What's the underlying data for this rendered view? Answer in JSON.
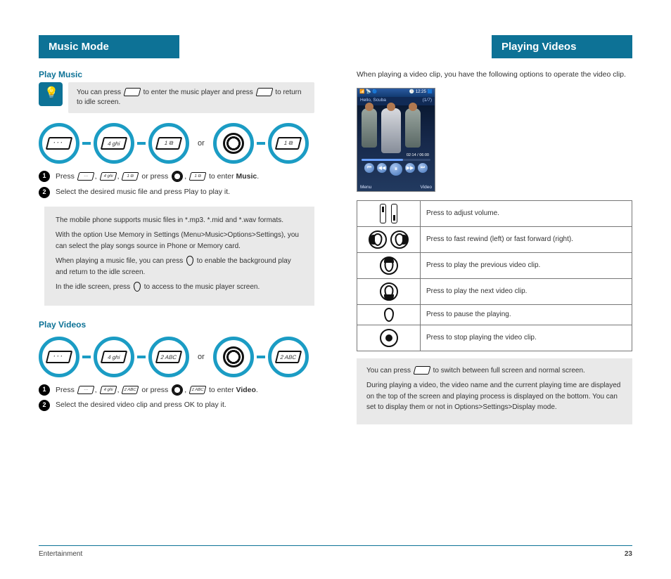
{
  "left": {
    "section_title": "Music Mode",
    "sub1": "Play Music",
    "tip": "You can press  to enter the music player and press  to return to idle screen.",
    "chain1_or": "or",
    "step1": "Press 4, 1 or press , 1 to enter Music.",
    "step2": "Select the desired music file and press Play to play it.",
    "box": {
      "l1": "The mobile phone supports music files in *.mp3. *.mid and *.wav formats.",
      "l2": "With the option Use Memory in Settings (Menu>Music>Options>Settings), you can select the play songs source in Phone or Memory card.",
      "l3": "When playing a music file, you can press  to enable the background play and return to the idle screen.",
      "l4": "In the idle screen, press  to access to the music player screen."
    },
    "sub2": "Play Videos",
    "chain2_or": "or",
    "step3": "Press 4, 2 or press , 2 to enter Video.",
    "step4": "Select the desired video clip and press OK to play it."
  },
  "right": {
    "section_title": "Playing Videos",
    "intro": "When playing a video clip, you have the following options to operate the video clip.",
    "phone": {
      "status_left": "📶 📡 🔵",
      "status_right": "🕒 12:25 🟦",
      "title_left": "Hello, Scuba",
      "title_right": "(1/7)",
      "time": "02:14 / 06:00",
      "sk_left": "Menu",
      "sk_right": "Video"
    },
    "table": {
      "r1": "Press to adjust volume.",
      "r2": "Press to fast rewind (left) or fast forward (right).",
      "r3": "Press to play the previous video clip.",
      "r4": "Press to play the next video clip.",
      "r5": "Press to pause the playing.",
      "r6": "Press to stop playing the video clip."
    },
    "tip": {
      "l1": "You can press  to switch between full screen and normal screen.",
      "l2": "During playing a video, the video name and the current playing time are displayed on the top of the screen and playing process is displayed on the bottom. You can set to display them or not in Options>Settings>Display mode."
    }
  },
  "footer": {
    "left": "Entertainment",
    "right": "23"
  }
}
